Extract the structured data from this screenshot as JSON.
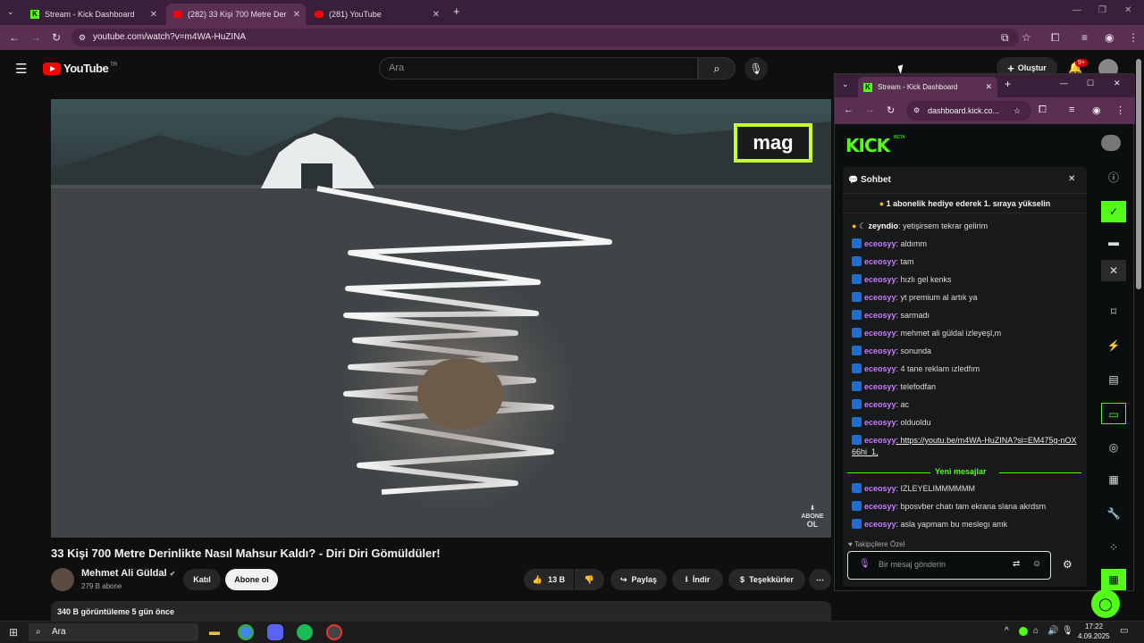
{
  "browser": {
    "tabs": [
      {
        "title": "Stream - Kick Dashboard"
      },
      {
        "title": "(282) 33 Kişi 700 Metre Der"
      },
      {
        "title": "(281) YouTube"
      }
    ],
    "url": "youtube.com/watch?v=m4WA-HuZINA"
  },
  "youtube": {
    "logo_text": "YouTube",
    "region": "TR",
    "search_placeholder": "Ara",
    "create_label": "Oluştur",
    "notif_count": "9+",
    "video_title": "33 Kişi 700 Metre Derinlikte Nasıl Mahsur Kaldı? - Diri Diri Gömüldüler!",
    "overlay_text": "mag",
    "watermark_line1": "ABONE",
    "watermark_line2": "OL",
    "channel": "Mehmet Ali Güldal",
    "subscribers": "279 B abone",
    "join_label": "Katıl",
    "subscribe_label": "Abone ol",
    "likes": "13 B",
    "share_label": "Paylaş",
    "download_label": "İndir",
    "thanks_label": "Teşekkürler",
    "views_line": "340 B görüntüleme  5 gün önce"
  },
  "popup": {
    "tab_title": "Stream - Kick Dashboard",
    "url": "dashboard.kick.co...",
    "logo": "KICK",
    "beta": "BETA",
    "chat_title": "Sohbet",
    "pinned": "1 abonelik hediye ederek 1. sıraya yükselin",
    "messages": [
      {
        "user": "zeyndio",
        "text": ": yetişirsem tekrar gelirim"
      },
      {
        "user": "eceosyy",
        "text": ": aldımm"
      },
      {
        "user": "eceosyy",
        "text": ": tam"
      },
      {
        "user": "eceosyy",
        "text": ": hızlı gel kenks"
      },
      {
        "user": "eceosyy",
        "text": ": yt premium al artık ya"
      },
      {
        "user": "eceosyy",
        "text": ": sarmadı"
      },
      {
        "user": "eceosyy",
        "text": ": mehmet ali güldal izleyeşl,m"
      },
      {
        "user": "eceosyy",
        "text": ": sonunda"
      },
      {
        "user": "eceosyy",
        "text": ": 4 tane reklam ızledfım"
      },
      {
        "user": "eceosyy",
        "text": ": telefodfan"
      },
      {
        "user": "eceosyy",
        "text": ": ac"
      },
      {
        "user": "eceosyy",
        "text": ": olduoldu"
      },
      {
        "user": "eceosyy",
        "text": ": https://youtu.be/m4WA-HuZINA?si=EM475g-nOX66hi_1,"
      }
    ],
    "new_messages_label": "Yeni mesajlar",
    "new_messages": [
      {
        "user": "eceosyy",
        "text": ": IZLEYELIMMMMMM"
      },
      {
        "user": "eceosyy",
        "text": ": bposvber chatı tam ekrana slana akrdsm"
      },
      {
        "user": "eceosyy",
        "text": ": asla yapmam bu meslegı amk"
      }
    ],
    "followers_only": "Takipçilere Özel",
    "input_placeholder": "Bir mesaj gönderin"
  },
  "taskbar": {
    "search": "Ara",
    "time": "17:22",
    "date": "4.09.2025"
  }
}
